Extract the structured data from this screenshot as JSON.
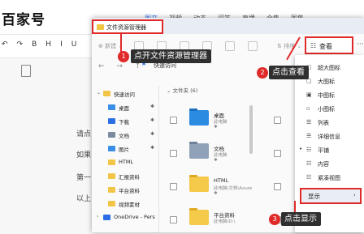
{
  "background": {
    "logo": "百家号",
    "nav": [
      "图文",
      "视频",
      "动态",
      "问答",
      "直播",
      "合集",
      "图集"
    ],
    "nav_active": 0,
    "toolbar": [
      "↶",
      "↷",
      "B",
      "H",
      "I",
      "U"
    ],
    "body_lines": [
      "请点",
      "如果",
      "第一",
      "以上"
    ]
  },
  "explorer": {
    "title": "文件资源管理器",
    "new_label": "⊕ 新建 ⌄",
    "sort_label": "⇅ 排序 ⌄",
    "view_label": "查看",
    "view_icon": "☷",
    "more_icon": "···",
    "nav_arrows": "← → ↑",
    "address": "快速访问",
    "sidebar": [
      {
        "label": "快速访问",
        "color": "#f3c546",
        "expand": "⌄"
      },
      {
        "label": "桌面",
        "color": "#3a8ee6"
      },
      {
        "label": "下载",
        "color": "#2b6ee6",
        "glyph": "↓"
      },
      {
        "label": "文档",
        "color": "#7a8ba0"
      },
      {
        "label": "图片",
        "color": "#3a8ee6"
      },
      {
        "label": "HTML",
        "color": "#f3c546"
      },
      {
        "label": "汇报资料",
        "color": "#f3c546"
      },
      {
        "label": "平台资料",
        "color": "#f3c546"
      },
      {
        "label": "视频素材",
        "color": "#f3c546"
      },
      {
        "label": "OneDrive - Pers",
        "color": "#2b6ee6",
        "expand": "›"
      }
    ],
    "section_header": "⌄ 文件夹 (6)",
    "folders": [
      {
        "name": "桌面",
        "sub": "此电脑",
        "color": "#2a8be0",
        "tab": "#1c6fc0",
        "pin": "✱"
      },
      {
        "name": "文档",
        "sub": "此电脑",
        "color": "#8fa2b8",
        "tab": "#6f8299",
        "pin": "✱"
      },
      {
        "name": "HTML",
        "sub": "此电脑\\文档\\Axure",
        "color": "#f5c94a",
        "tab": "#e0aa22",
        "pin": "✱"
      },
      {
        "name": "平台资料",
        "sub": "此电脑\\D:\\",
        "color": "#f5c94a",
        "tab": "#e0aa22",
        "pin": ""
      }
    ]
  },
  "view_menu": {
    "items": [
      {
        "icon": "▢",
        "label": "超大图标"
      },
      {
        "icon": "▢",
        "label": "大图标"
      },
      {
        "icon": "▣",
        "label": "中图标"
      },
      {
        "icon": "▫",
        "label": "小图标"
      },
      {
        "icon": "☰",
        "label": "列表"
      },
      {
        "icon": "☰",
        "label": "详细信息"
      },
      {
        "icon": "☷",
        "label": "平铺",
        "selected": true
      },
      {
        "icon": "☷",
        "label": "内容"
      },
      {
        "icon": "☷",
        "label": "紧凑视图"
      }
    ],
    "show_label": "显示",
    "show_arrow": "›"
  },
  "callouts": [
    {
      "num": "1",
      "text": "点开文件资源管理器"
    },
    {
      "num": "2",
      "text": "点击查看"
    },
    {
      "num": "3",
      "text": "点击显示"
    }
  ],
  "colors": {
    "accent": "#2b6ee6",
    "highlight": "#e02a2a",
    "callout_bg": "#2f2f2f"
  }
}
